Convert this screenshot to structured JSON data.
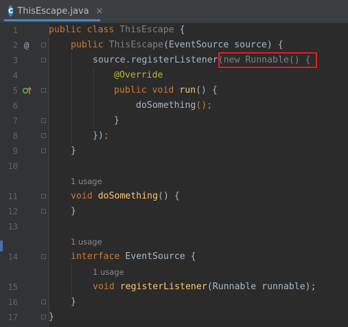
{
  "tab": {
    "icon_letter": "C",
    "filename": "ThisEscape.java",
    "close": "×"
  },
  "lines": [
    {
      "num": "1",
      "parts": [
        {
          "t": "public ",
          "c": "kw"
        },
        {
          "t": "class ",
          "c": "kw"
        },
        {
          "t": "ThisEscape",
          "c": "id"
        },
        {
          "t": " {",
          "c": "id"
        }
      ]
    },
    {
      "num": "2",
      "gutter": "@",
      "parts": [
        {
          "t": "public ",
          "c": "kw"
        },
        {
          "t": "ThisEscape",
          "c": "muted"
        },
        {
          "t": "(EventSource source) {",
          "c": "id"
        }
      ]
    },
    {
      "num": "3",
      "parts": [
        {
          "t": "source.registerListener",
          "c": "id"
        },
        {
          "t": "(new Runnable() {",
          "c": "muted"
        }
      ]
    },
    {
      "num": "4",
      "parts": [
        {
          "t": "@Override",
          "c": "ann"
        }
      ]
    },
    {
      "num": "5",
      "gutter": "icon",
      "parts": [
        {
          "t": "public ",
          "c": "kw"
        },
        {
          "t": "void ",
          "c": "kw"
        },
        {
          "t": "run",
          "c": "fn"
        },
        {
          "t": "() {",
          "c": "id"
        }
      ]
    },
    {
      "num": "6",
      "parts": [
        {
          "t": "doSomething",
          "c": "id"
        },
        {
          "t": "();",
          "c": "kw"
        }
      ]
    },
    {
      "num": "7",
      "parts": [
        {
          "t": "}",
          "c": "id"
        }
      ]
    },
    {
      "num": "8",
      "parts": [
        {
          "t": "});",
          "c": "id"
        }
      ]
    },
    {
      "num": "9",
      "parts": [
        {
          "t": "}",
          "c": "id"
        }
      ]
    },
    {
      "num": "10",
      "parts": []
    },
    {
      "num": "11",
      "usage": "1 usage",
      "parts": [
        {
          "t": "void ",
          "c": "kw"
        },
        {
          "t": "doSomething",
          "c": "fn"
        },
        {
          "t": "() {",
          "c": "id"
        }
      ]
    },
    {
      "num": "12",
      "parts": [
        {
          "t": "}",
          "c": "id"
        }
      ]
    },
    {
      "num": "13",
      "parts": []
    },
    {
      "num": "14",
      "usage": "1 usage",
      "parts": [
        {
          "t": "interface ",
          "c": "kw"
        },
        {
          "t": "EventSource {",
          "c": "id"
        }
      ]
    },
    {
      "num": "15",
      "usage": "1 usage",
      "parts": [
        {
          "t": "void ",
          "c": "kw"
        },
        {
          "t": "registerListener",
          "c": "fn"
        },
        {
          "t": "(Runnable runnable);",
          "c": "id"
        }
      ]
    },
    {
      "num": "16",
      "parts": [
        {
          "t": "}",
          "c": "id"
        }
      ]
    },
    {
      "num": "17",
      "parts": [
        {
          "t": "}",
          "c": "id"
        }
      ]
    }
  ]
}
